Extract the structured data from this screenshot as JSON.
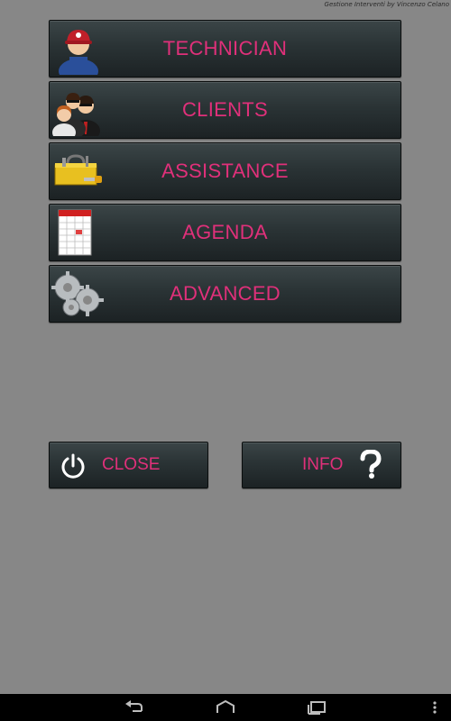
{
  "app": {
    "credit": "Gestione Interventi by Vincenzo Celano"
  },
  "menu": [
    {
      "label": "TECHNICIAN",
      "icon": "technician-icon"
    },
    {
      "label": "CLIENTS",
      "icon": "clients-icon"
    },
    {
      "label": "ASSISTANCE",
      "icon": "toolbox-icon"
    },
    {
      "label": "AGENDA",
      "icon": "calendar-icon"
    },
    {
      "label": "ADVANCED",
      "icon": "gears-icon"
    }
  ],
  "bottom": {
    "close_label": "CLOSE",
    "close_icon": "power-icon",
    "info_label": "INFO",
    "info_icon": "question-mark-icon"
  },
  "navbar": {
    "back_icon": "back-icon",
    "home_icon": "home-icon",
    "recents_icon": "recents-icon",
    "overflow_icon": "overflow-menu-icon"
  },
  "colors": {
    "background": "#878787",
    "label": "#e0307a",
    "button": "#2a3335"
  }
}
